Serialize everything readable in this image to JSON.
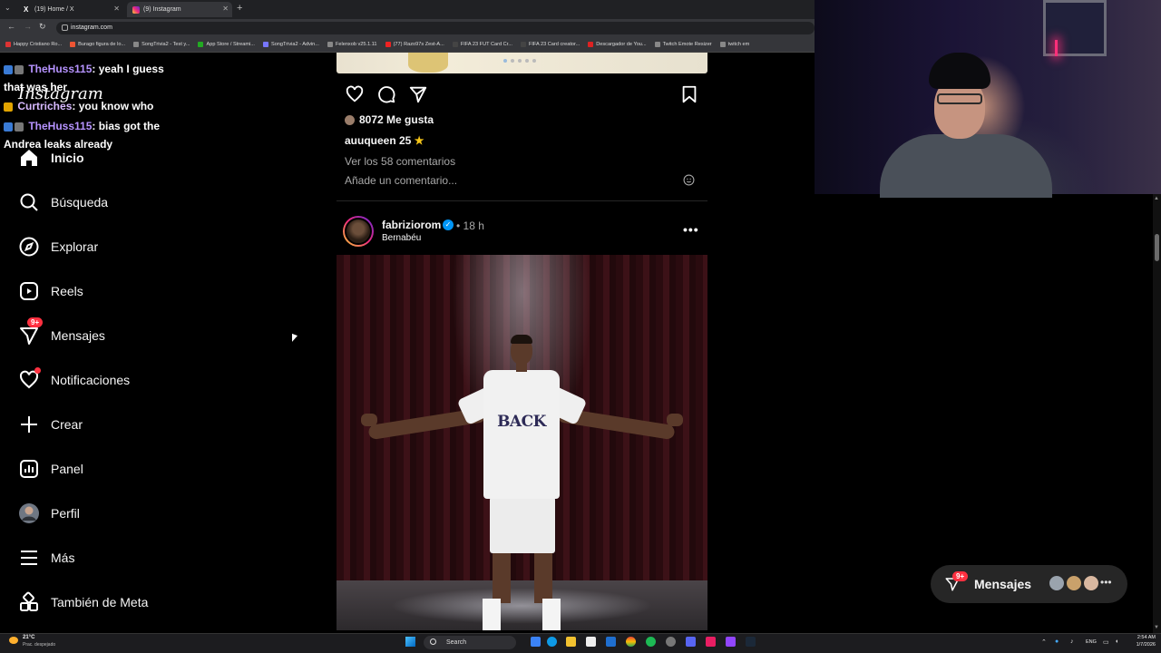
{
  "browser": {
    "tabs": [
      {
        "label": "(19) Home / X",
        "favicon": "x-logo-icon",
        "active": false
      },
      {
        "label": "(9) Instagram",
        "favicon": "instagram-icon",
        "active": true
      }
    ],
    "address": "instagram.com",
    "bookmarks": [
      {
        "label": "Happy Cristiano Ro...",
        "color": "#d33"
      },
      {
        "label": "Burago figura de lo...",
        "color": "#e53"
      },
      {
        "label": "SongTrivia2 - Test y...",
        "color": "#888"
      },
      {
        "label": "App Store / Streami...",
        "color": "#2a2"
      },
      {
        "label": "SongTrivia2 - Advin...",
        "color": "#77f"
      },
      {
        "label": "Felenxob v25.1.11",
        "color": "#888"
      },
      {
        "label": "(77) Razo97s Zest-A...",
        "color": "#e22"
      },
      {
        "label": "FIFA 23 FUT Card Cr...",
        "color": "#444"
      },
      {
        "label": "FIFA 23 Card creator...",
        "color": "#444"
      },
      {
        "label": "Descargador de You...",
        "color": "#d22"
      },
      {
        "label": "Twitch Emote Resizer",
        "color": "#888"
      },
      {
        "label": "twitch em",
        "color": "#888"
      }
    ]
  },
  "chat": [
    {
      "user": "TheHuss115",
      "message": ": yeah I guess that was her"
    },
    {
      "user": "Curtriches",
      "message": ": you know who"
    },
    {
      "user": "TheHuss115",
      "message": ": bias got the Andrea leaks already"
    }
  ],
  "instagram": {
    "logo": "Instagram",
    "nav": [
      {
        "label": "Inicio",
        "icon": "home-icon",
        "bold": true
      },
      {
        "label": "Búsqueda",
        "icon": "search-icon"
      },
      {
        "label": "Explorar",
        "icon": "compass-icon"
      },
      {
        "label": "Reels",
        "icon": "reels-icon"
      },
      {
        "label": "Mensajes",
        "icon": "direct-icon",
        "badge": "9+"
      },
      {
        "label": "Notificaciones",
        "icon": "heart-icon",
        "dot": true
      },
      {
        "label": "Crear",
        "icon": "plus-icon"
      },
      {
        "label": "Panel",
        "icon": "dashboard-icon"
      },
      {
        "label": "Perfil",
        "icon": "profile-avatar"
      },
      {
        "label": "Más",
        "icon": "menu-icon"
      },
      {
        "label": "También de Meta",
        "icon": "meta-apps-icon"
      }
    ],
    "prev_post": {
      "likes": "8072 Me gusta",
      "caption": "auuqueen 25",
      "caption_emoji": "★",
      "view_comments": "Ver los 58 comentarios",
      "add_comment": "Añade un comentario..."
    },
    "post": {
      "username": "fabriziorom",
      "time_sep": "•",
      "time": "18 h",
      "location": "Bernabéu",
      "more": "•••",
      "shirt_text": "BACK"
    },
    "messages_pill": {
      "label": "Mensajes",
      "badge": "9+",
      "more": "•••"
    }
  },
  "taskbar": {
    "weather_temp": "21°C",
    "weather_desc": "Prac. despejado",
    "search": "Search",
    "lang": "ENG",
    "time": "2:54 AM",
    "date": "1/7/2026"
  },
  "colors": {
    "accent": "#0095f6",
    "notification": "#ff3040",
    "chat_user": "#b693ff"
  }
}
